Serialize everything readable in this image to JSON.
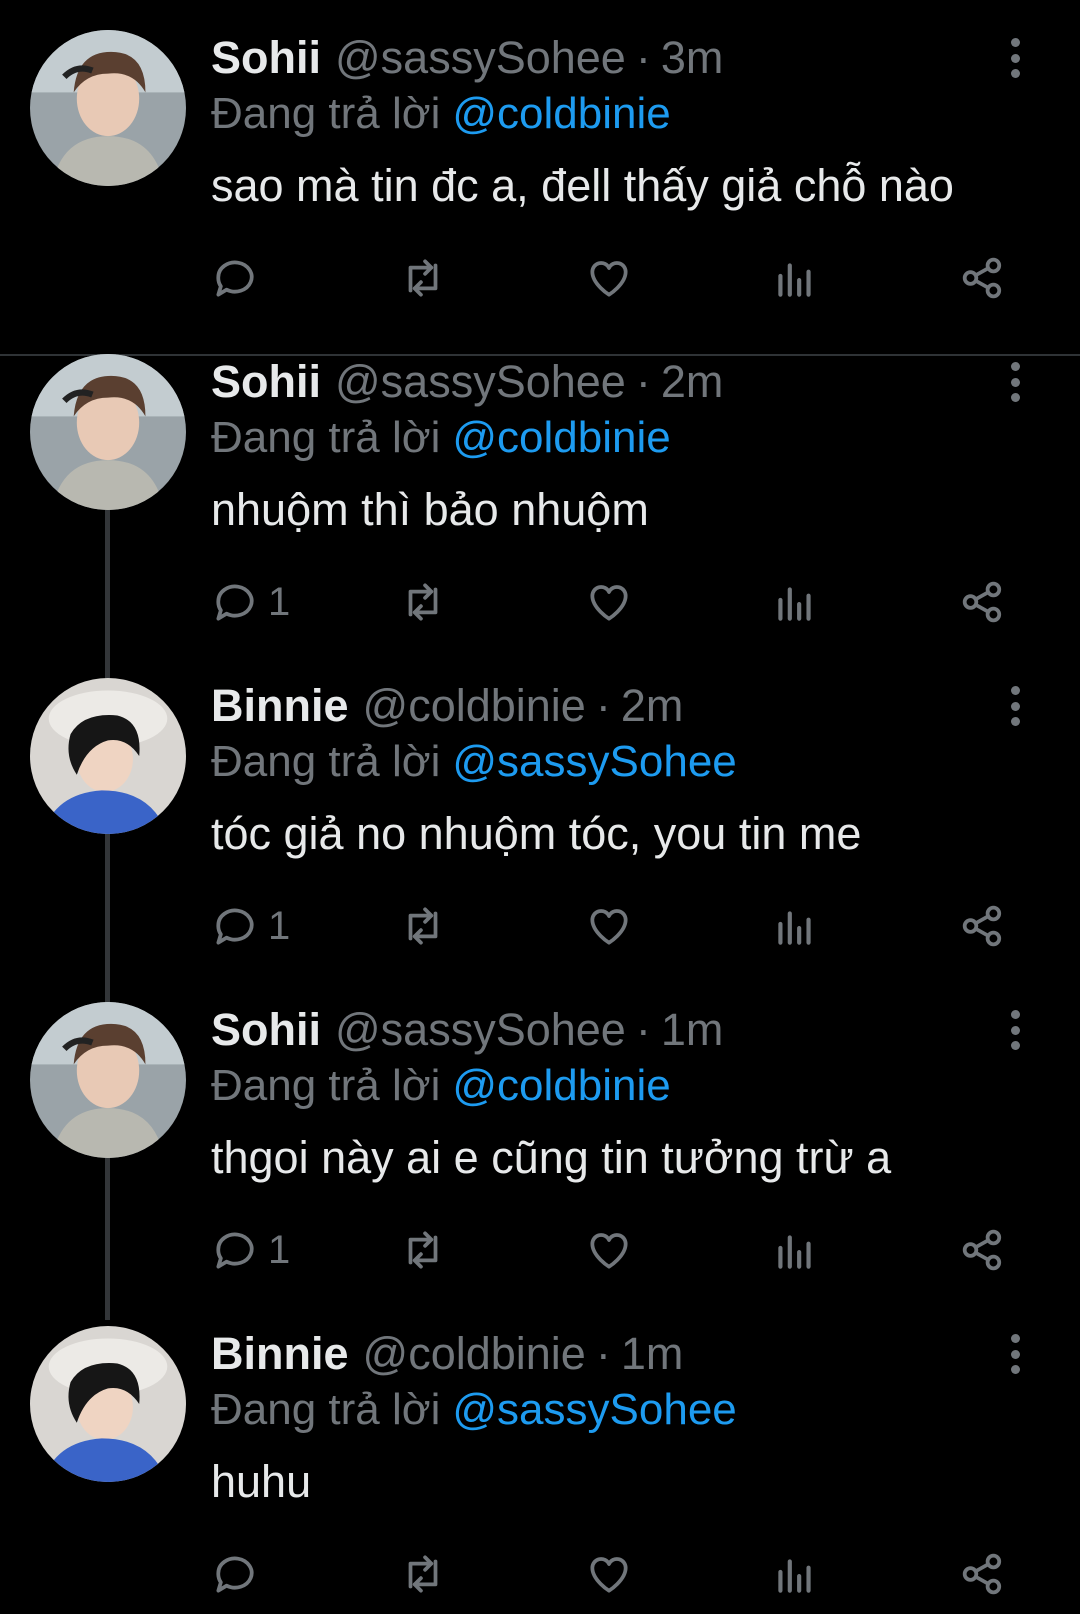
{
  "reply_prefix": "Đang trả lời",
  "colors": {
    "background": "#000000",
    "primary_text": "#e7e9ea",
    "secondary_text": "#71767b",
    "link": "#1d9bf0",
    "divider": "#2f3336"
  },
  "icons": {
    "reply": "speech-bubble-icon",
    "retweet": "retweet-icon",
    "like": "heart-icon",
    "views": "bar-chart-icon",
    "share": "share-icon",
    "more": "vertical-ellipsis-icon"
  },
  "tweets": [
    {
      "name": "Sohii",
      "handle": "@sassySohee",
      "time": "3m",
      "reply_to": "@coldbinie",
      "text": "sao mà tin đc a, đell thấy giả chỗ nào",
      "reply_count": ""
    },
    {
      "name": "Sohii",
      "handle": "@sassySohee",
      "time": "2m",
      "reply_to": "@coldbinie",
      "text": "nhuộm thì bảo nhuộm",
      "reply_count": "1"
    },
    {
      "name": "Binnie",
      "handle": "@coldbinie",
      "time": "2m",
      "reply_to": "@sassySohee",
      "text": "tóc giả no nhuộm tóc, you tin me",
      "reply_count": "1"
    },
    {
      "name": "Sohii",
      "handle": "@sassySohee",
      "time": "1m",
      "reply_to": "@coldbinie",
      "text": "thgoi này ai e cũng tin tưởng trừ a",
      "reply_count": "1"
    },
    {
      "name": "Binnie",
      "handle": "@coldbinie",
      "time": "1m",
      "reply_to": "@sassySohee",
      "text": "huhu",
      "reply_count": ""
    }
  ]
}
